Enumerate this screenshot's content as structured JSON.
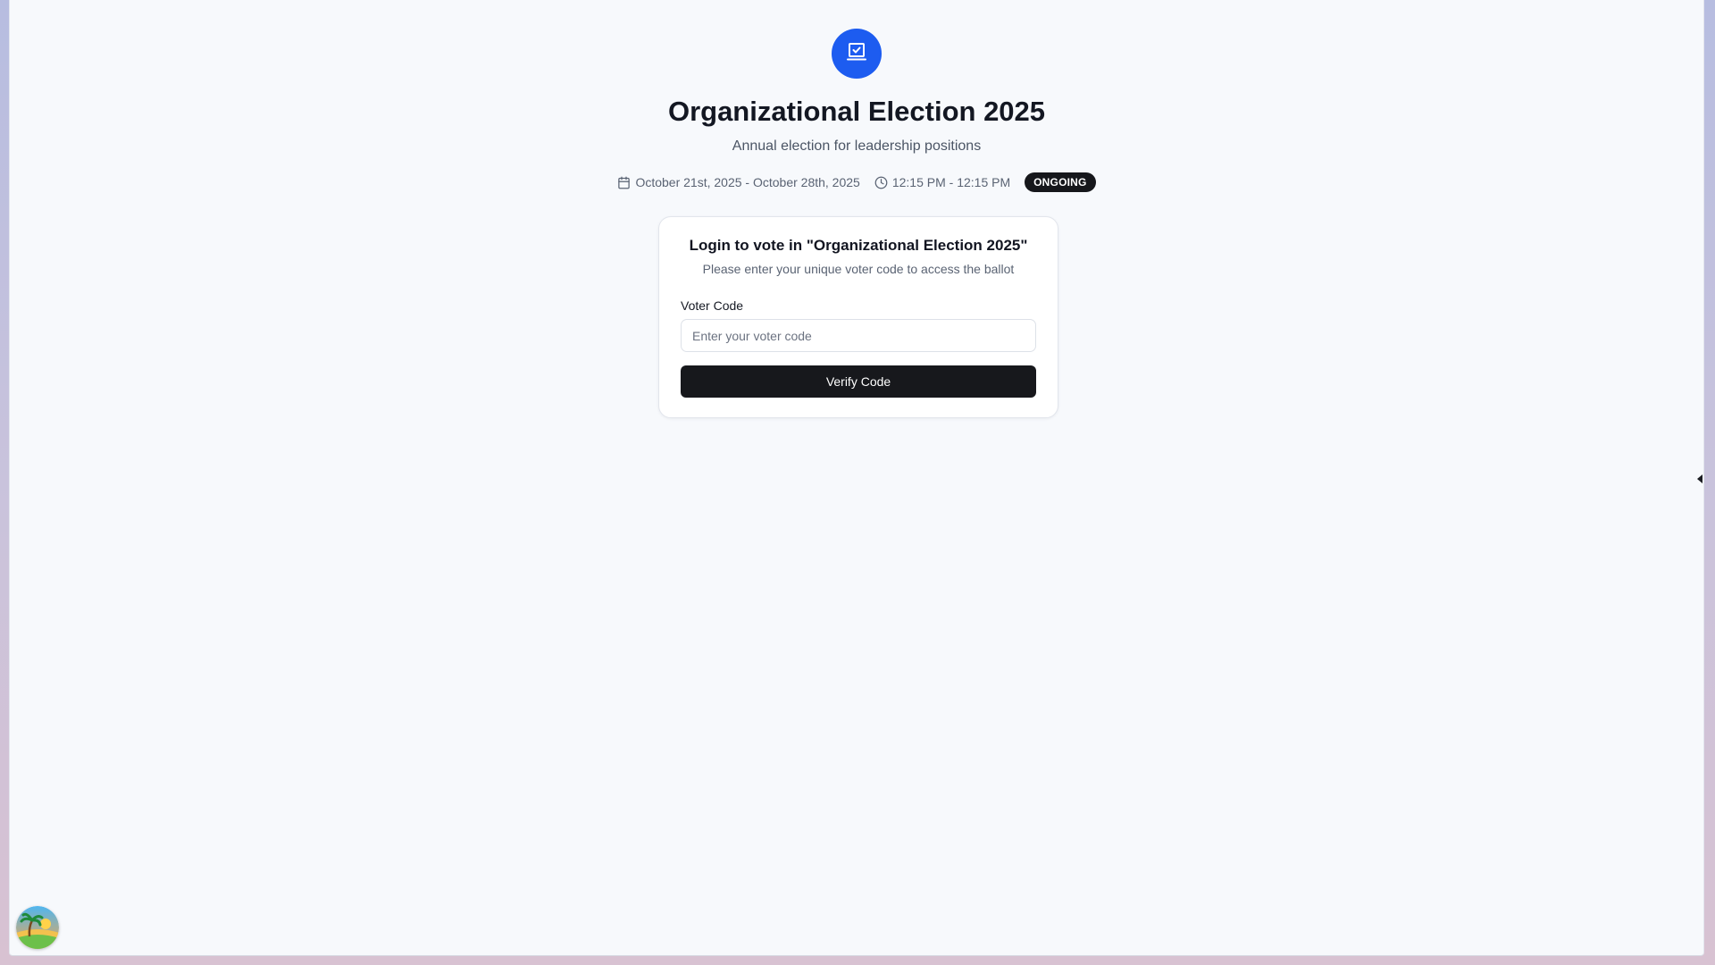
{
  "election": {
    "title": "Organizational Election 2025",
    "description": "Annual election for leadership positions",
    "date_range": "October 21st, 2025 - October 28th, 2025",
    "time_range": "12:15 PM - 12:15 PM",
    "status": "ONGOING",
    "logo_icon": "vote-laptop-check-icon"
  },
  "login": {
    "title": "Login to vote in \"Organizational Election 2025\"",
    "subtitle": "Please enter your unique voter code to access the ballot",
    "voter_code_label": "Voter Code",
    "voter_code_placeholder": "Enter your voter code",
    "voter_code_value": "",
    "verify_button": "Verify Code"
  },
  "icons": {
    "date": "calendar-icon",
    "time": "clock-icon",
    "side_toggle": "caret-left-icon",
    "avatar": "beach-avatar-icon"
  },
  "colors": {
    "accent": "#1d5cf0",
    "badge_bg": "#16171b",
    "button_bg": "#17181c",
    "page_bg": "#f7f9fc"
  }
}
